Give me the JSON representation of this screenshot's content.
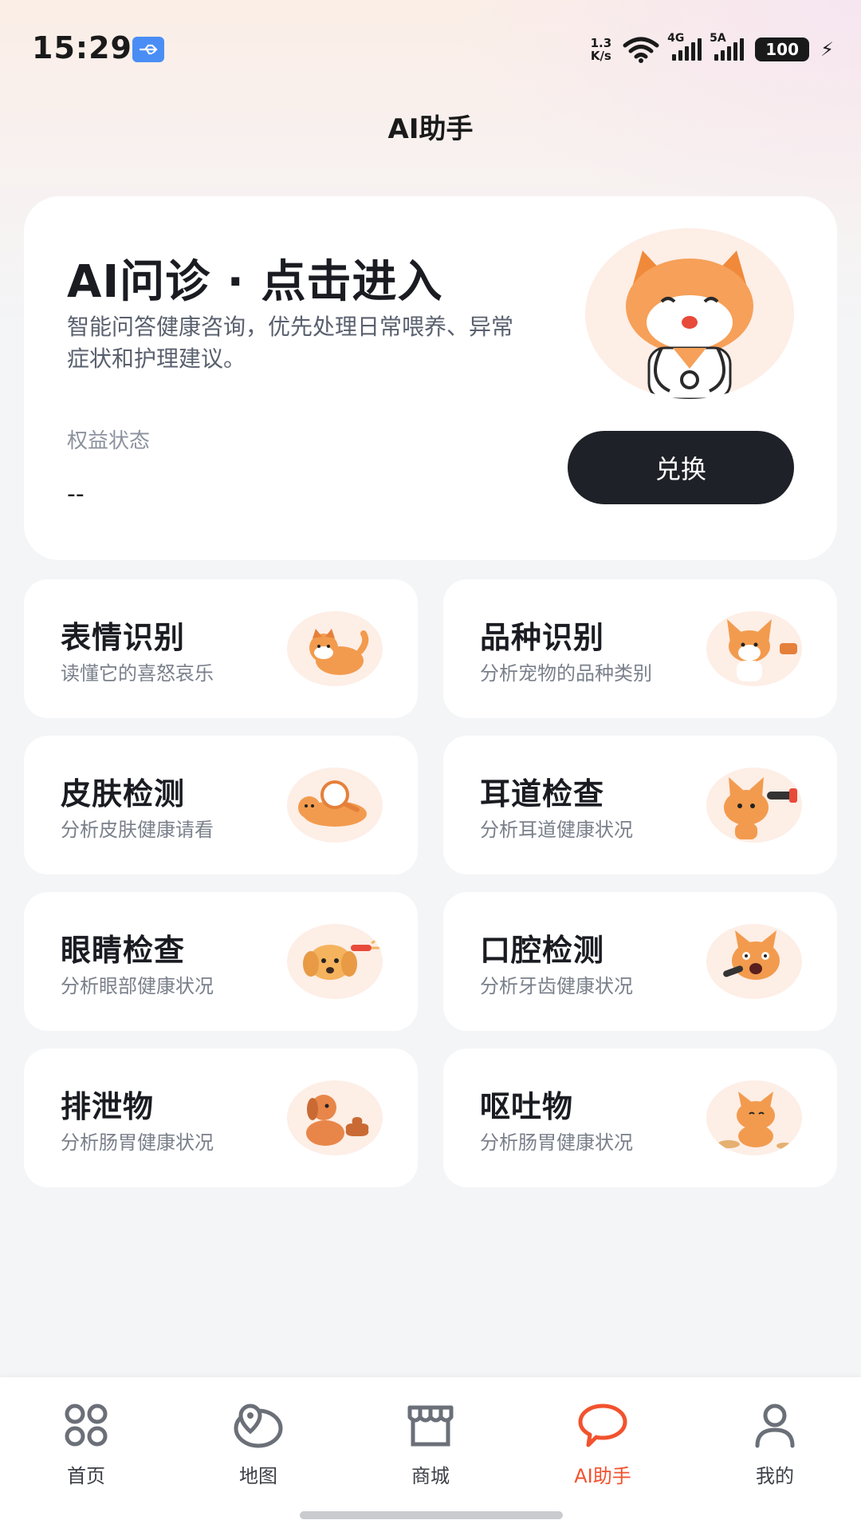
{
  "status_bar": {
    "time": "15:29",
    "net_speed_top": "1.3",
    "net_speed_bottom": "K/s",
    "signal1_tag": "4G",
    "signal2_tag": "5A",
    "battery": "100",
    "icons": [
      "usb-icon",
      "wifi-icon",
      "signal-icon",
      "battery-icon",
      "charging-icon"
    ]
  },
  "page_title": "AI助手",
  "hero": {
    "title": "AI问诊 · 点击进入",
    "description": "智能问答健康咨询，优先处理日常喂养、异常症状和护理建议。",
    "benefit_label": "权益状态",
    "benefit_value": "--",
    "redeem_button": "兑换",
    "image": "cat-doctor-illustration"
  },
  "features": [
    {
      "title": "表情识别",
      "subtitle": "读懂它的喜怒哀乐",
      "image": "shiba-illustration"
    },
    {
      "title": "品种识别",
      "subtitle": "分析宠物的品种类别",
      "image": "corgi-illustration"
    },
    {
      "title": "皮肤检测",
      "subtitle": "分析皮肤健康请看",
      "image": "cat-magnifier-illustration"
    },
    {
      "title": "耳道检查",
      "subtitle": "分析耳道健康状况",
      "image": "cat-otoscope-illustration"
    },
    {
      "title": "眼睛检查",
      "subtitle": "分析眼部健康状况",
      "image": "puppy-flashlight-illustration"
    },
    {
      "title": "口腔检测",
      "subtitle": "分析牙齿健康状况",
      "image": "cat-mouth-illustration"
    },
    {
      "title": "排泄物",
      "subtitle": "分析肠胃健康状况",
      "image": "dog-poop-illustration"
    },
    {
      "title": "呕吐物",
      "subtitle": "分析肠胃健康状况",
      "image": "cat-vomit-illustration"
    }
  ],
  "tabbar": {
    "items": [
      {
        "label": "首页",
        "icon": "home-grid-icon"
      },
      {
        "label": "地图",
        "icon": "map-pin-icon"
      },
      {
        "label": "商城",
        "icon": "store-icon"
      },
      {
        "label": "AI助手",
        "icon": "chat-bubble-icon",
        "active": true
      },
      {
        "label": "我的",
        "icon": "profile-icon"
      }
    ]
  },
  "colors": {
    "accent": "#f2522e",
    "dark_button": "#1e2127",
    "thumb_bg": "#fdeee6",
    "page_bg": "#f4f5f7"
  }
}
